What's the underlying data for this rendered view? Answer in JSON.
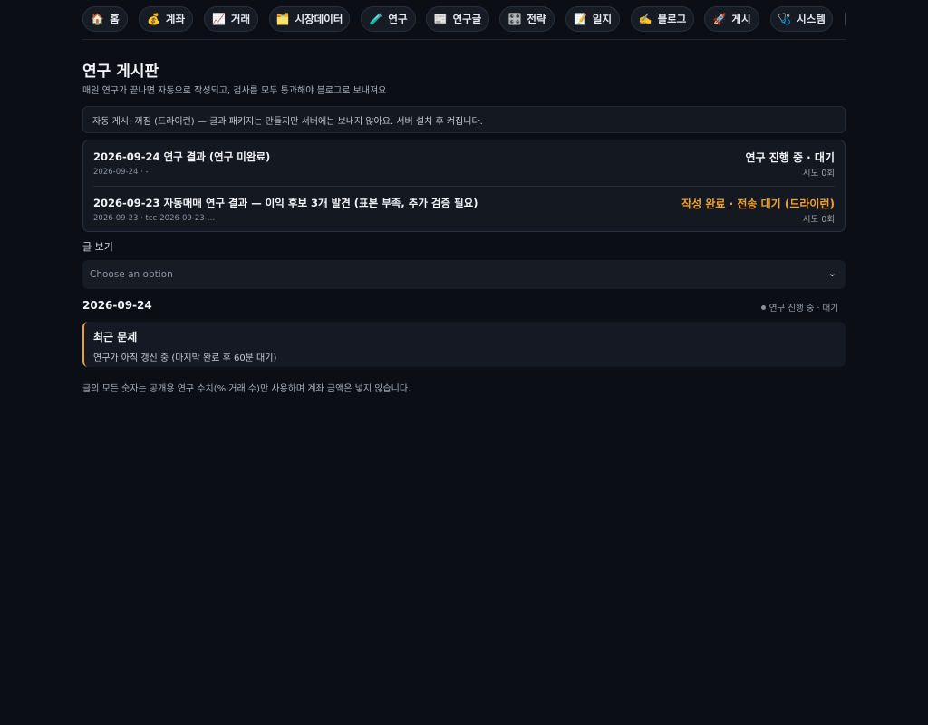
{
  "nav": {
    "items": [
      {
        "icon": "🏠",
        "label": "홈"
      },
      {
        "icon": "💰",
        "label": "계좌"
      },
      {
        "icon": "📈",
        "label": "거래"
      },
      {
        "icon": "🗂️",
        "label": "시장데이터"
      },
      {
        "icon": "🧪",
        "label": "연구"
      },
      {
        "icon": "📰",
        "label": "연구글"
      },
      {
        "icon": "🎛️",
        "label": "전략"
      },
      {
        "icon": "📝",
        "label": "일지"
      },
      {
        "icon": "✍️",
        "label": "블로그"
      },
      {
        "icon": "🚀",
        "label": "게시"
      },
      {
        "icon": "🩺",
        "label": "시스템"
      }
    ]
  },
  "page": {
    "title": "연구 게시판",
    "subtitle": "매일 연구가 끝나면 자동으로 작성되고, 검사를 모두 통과해야 블로그로 보내져요"
  },
  "notice": "자동 게시: 꺼짐 (드라이런) — 글과 패키지는 만들지만 서버에는 보내지 않아요. 서버 설치 후 켜집니다.",
  "list": [
    {
      "title": "2026-09-24 연구 결과 (연구 미완료)",
      "meta": "2026-09-24 · -",
      "status": "연구 진행 중 · 대기",
      "tries": "시도 0회"
    },
    {
      "title": "2026-09-23 자동매매 연구 결과 — 이익 후보 3개 발견 (표본 부족, 추가 검증 필요)",
      "meta": "2026-09-23 · tcc-2026-09-23-…",
      "status": "작성 완료 · 전송 대기 (드라이런)",
      "tries": "시도 0회"
    }
  ],
  "viewer": {
    "label": "글 보기",
    "placeholder": "Choose an option"
  },
  "detail": {
    "date": "2026-09-24",
    "status": "연구 진행 중 · 대기",
    "issue_title": "최근 문제",
    "issue_body": "연구가 아직 갱신 중 (마지막 완료 후 60분 대기)"
  },
  "footnote": "글의 모든 숫자는 공개용 연구 수치(%·거래 수)만 사용하며 계좌 금액은 넣지 않습니다.",
  "colors": {
    "background": "#0b0e14",
    "accent_orange": "#f0a02c"
  }
}
